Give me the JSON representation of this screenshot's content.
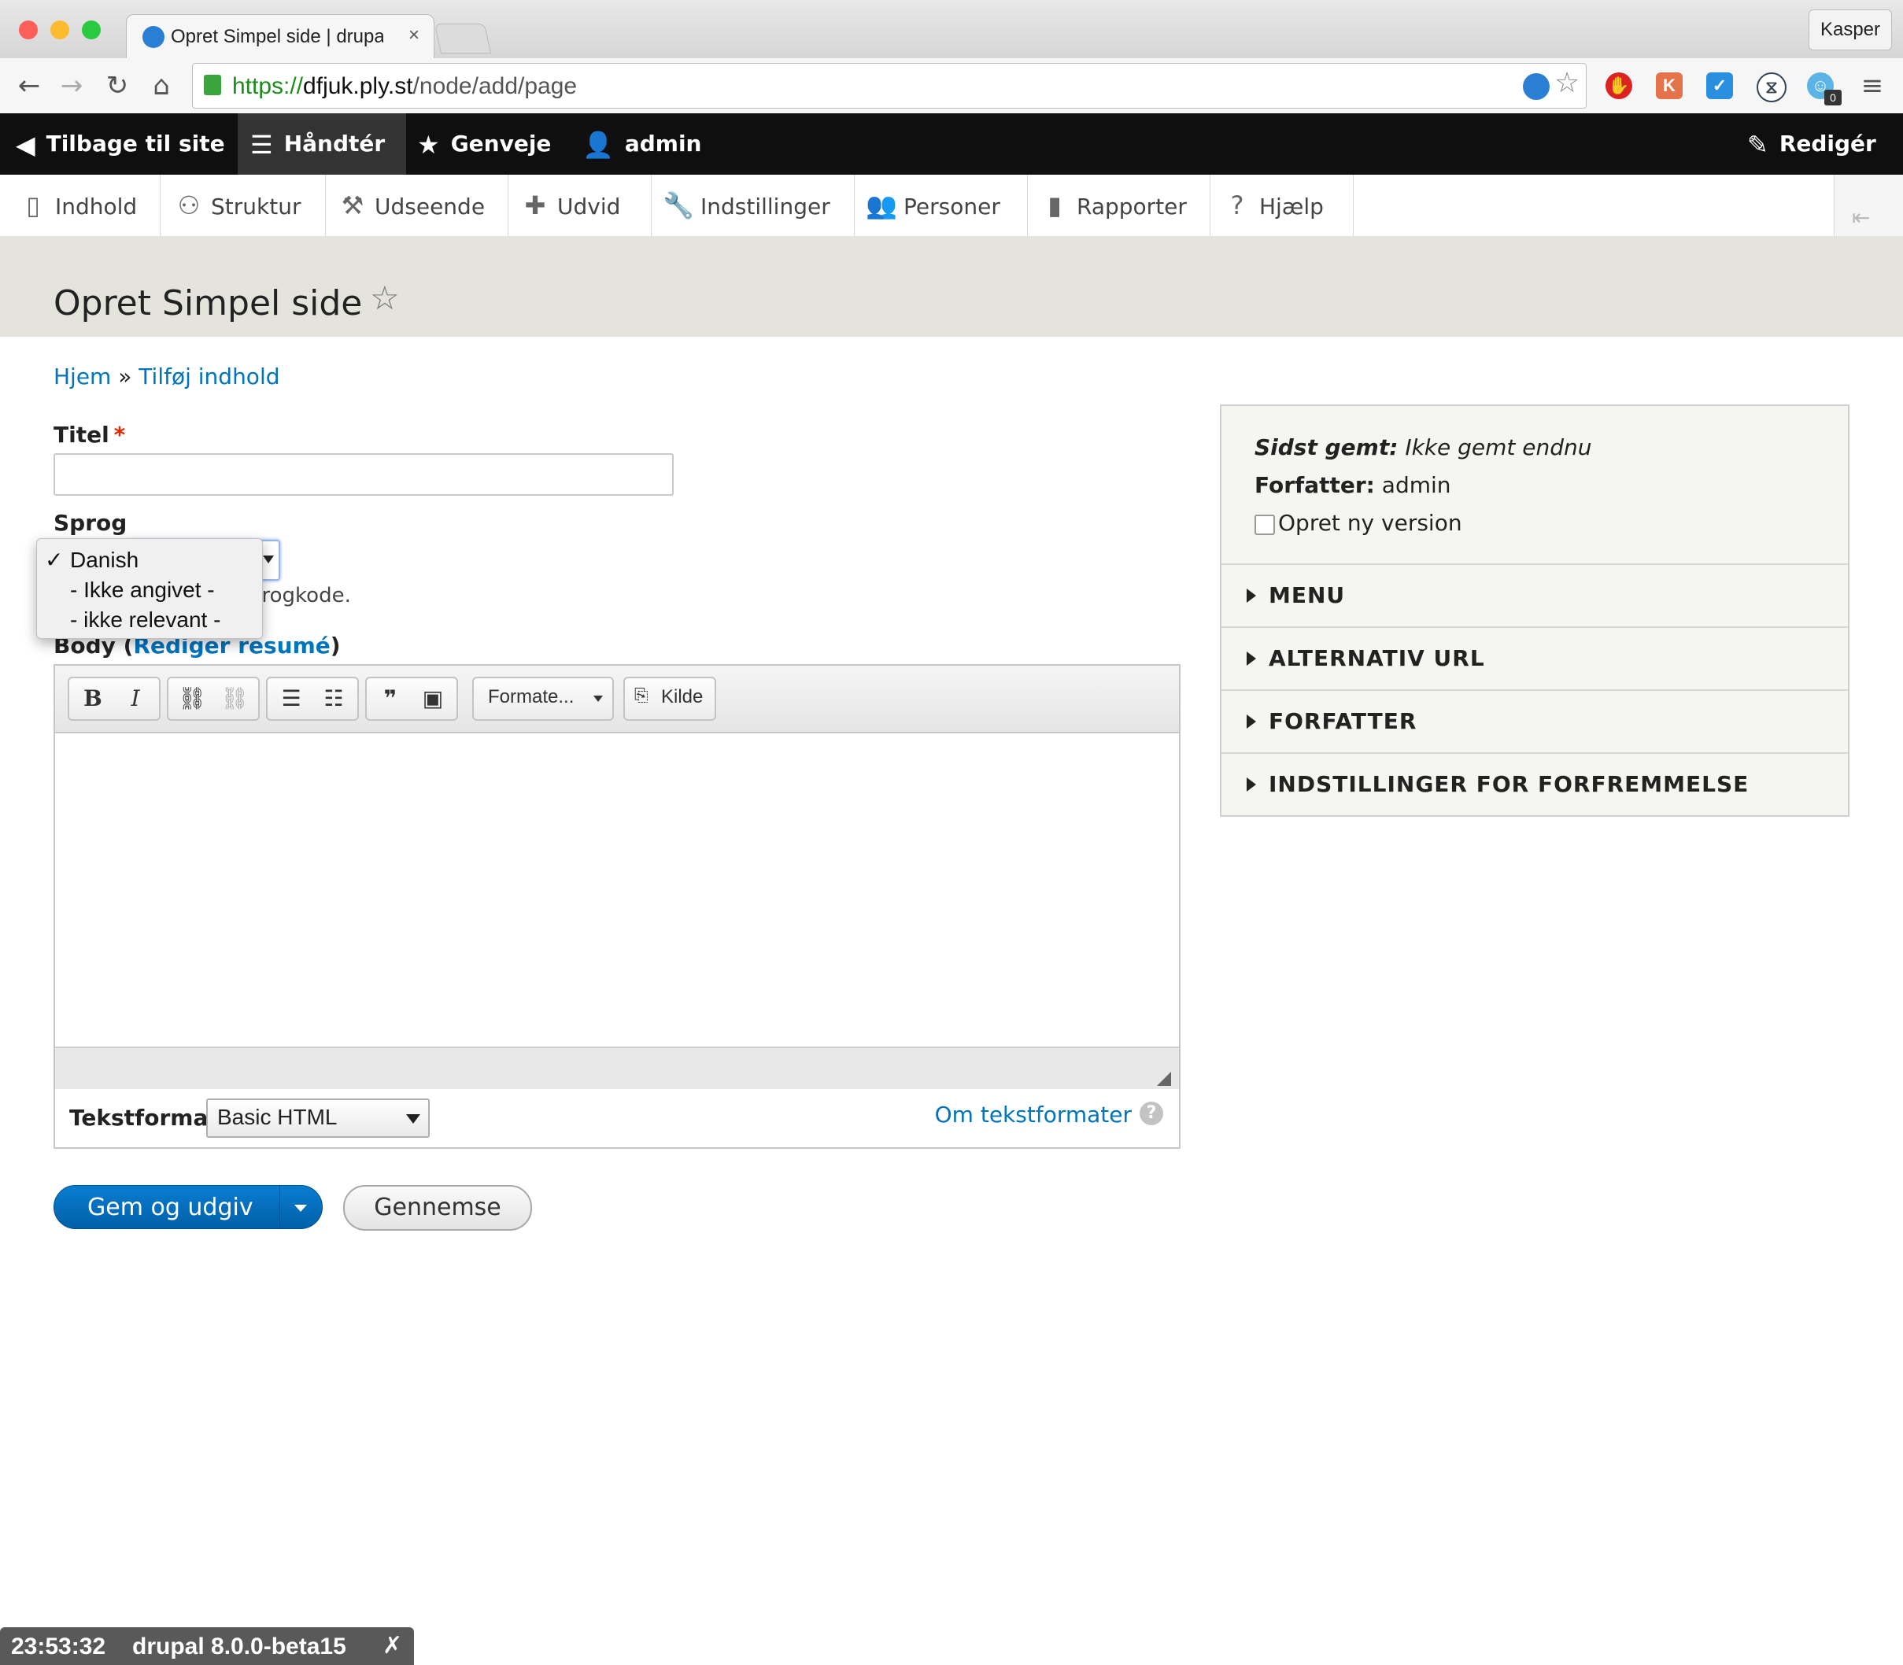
{
  "browser": {
    "tab_title": "Opret Simpel side | drupal",
    "tab_close": "×",
    "profile": "Kasper",
    "url_scheme": "https://",
    "url_host": "dfjuk.ply.st",
    "url_path": "/node/add/page",
    "ext_badge": "0"
  },
  "adminbar": {
    "back": "Tilbage til site",
    "manage": "Håndtér",
    "shortcuts": "Genveje",
    "user": "admin",
    "edit": "Redigér"
  },
  "tray": {
    "items": [
      "Indhold",
      "Struktur",
      "Udseende",
      "Udvid",
      "Indstillinger",
      "Personer",
      "Rapporter",
      "Hjælp"
    ]
  },
  "page": {
    "title": "Opret Simpel side",
    "breadcrumb_home": "Hjem",
    "breadcrumb_sep": "»",
    "breadcrumb_current": "Tilføj indhold"
  },
  "form": {
    "title_label": "Titel",
    "required_mark": "*",
    "title_value": "",
    "language_label": "Sprog",
    "language_desc": "progkode.",
    "language_options": [
      "Danish",
      "- Ikke angivet -",
      "- ikke relevant -"
    ],
    "language_selected_mark": "✓",
    "body_label": "Body",
    "body_paren_open": "(",
    "body_summary_link": "Rediger resumé",
    "body_paren_close": ")",
    "toolbar": {
      "bold": "B",
      "italic": "I",
      "format_dropdown": "Formate...",
      "source": "Kilde"
    },
    "text_format_label": "Tekstformat",
    "text_format_value": "Basic HTML",
    "text_format_help": "Om tekstformater",
    "help_icon": "?",
    "save_button": "Gem og udgiv",
    "preview_button": "Gennemse"
  },
  "sidebar": {
    "last_saved_label": "Sidst gemt:",
    "last_saved_value": "Ikke gemt endnu",
    "author_label": "Forfatter:",
    "author_value": "admin",
    "new_revision": "Opret ny version",
    "sections": [
      "MENU",
      "ALTERNATIV URL",
      "FORFATTER",
      "INDSTILLINGER FOR FORFREMMELSE"
    ]
  },
  "overlay": {
    "time": "23:53:32",
    "version": "drupal 8.0.0-beta15",
    "close": "✗"
  },
  "colors": {
    "link": "#0074bd",
    "primary_button": "#0074bd",
    "adminbar_bg": "#0f0f0f",
    "header_bg": "#e5e4dc",
    "required": "#e32700"
  }
}
